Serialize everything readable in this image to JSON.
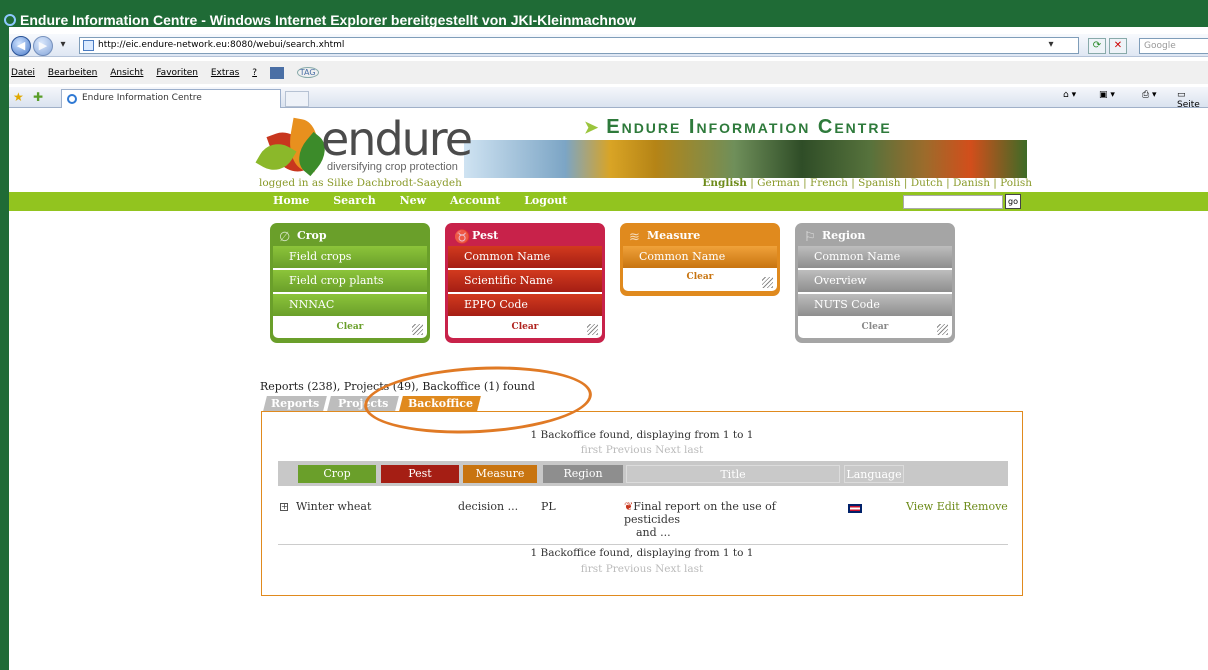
{
  "window": {
    "title": "Endure Information Centre - Windows Internet Explorer bereitgestellt von JKI-Kleinmachnow"
  },
  "browser": {
    "url": "http://eic.endure-network.eu:8080/webui/search.xhtml",
    "search_placeholder": "Google",
    "menu": [
      "Datei",
      "Bearbeiten",
      "Ansicht",
      "Favoriten",
      "Extras",
      "?"
    ],
    "tag_label": "TAG",
    "tab_title": "Endure Information Centre",
    "page_cmd": "Seite"
  },
  "site": {
    "logo_word": "endure",
    "logo_tagline": "diversifying crop protection",
    "banner_title": "Endure Information Centre",
    "logged_in": "logged in as Silke Dachbrodt-Saaydeh",
    "languages": {
      "active": "English",
      "rest": "| German | French | Spanish | Dutch | Danish | Polish"
    },
    "nav": [
      "Home",
      "Search",
      "New",
      "Account",
      "Logout"
    ],
    "go_label": "go"
  },
  "panels": {
    "crop": {
      "title": "Crop",
      "items": [
        "Field crops",
        "Field crop plants",
        "NNNAC"
      ],
      "clear": "Clear",
      "color": "#6a9f2a"
    },
    "pest": {
      "title": "Pest",
      "items": [
        "Common Name",
        "Scientific Name",
        "EPPO Code"
      ],
      "clear": "Clear",
      "color": "#c8224a"
    },
    "measure": {
      "title": "Measure",
      "items": [
        "Common Name"
      ],
      "clear": "Clear",
      "color": "#e08a1e"
    },
    "region": {
      "title": "Region",
      "items": [
        "Common Name",
        "Overview",
        "NUTS Code"
      ],
      "clear": "Clear",
      "color": "#a5a5a5"
    }
  },
  "results": {
    "summary": "Reports (238), Projects (49), Backoffice (1) found",
    "tabs": [
      "Reports",
      "Projects",
      "Backoffice"
    ],
    "found_text": "1 Backoffice found, displaying from 1 to 1",
    "pager": "first Previous  Next last",
    "columns": [
      "Crop",
      "Pest",
      "Measure",
      "Region",
      "Title",
      "Language"
    ],
    "row": {
      "crop": "Winter wheat",
      "measure": "decision ...",
      "region": "PL",
      "title_line1": "Final report on the use of pesticides",
      "title_line2": "and ...",
      "actions": [
        "View",
        "Edit",
        "Remove"
      ]
    }
  }
}
